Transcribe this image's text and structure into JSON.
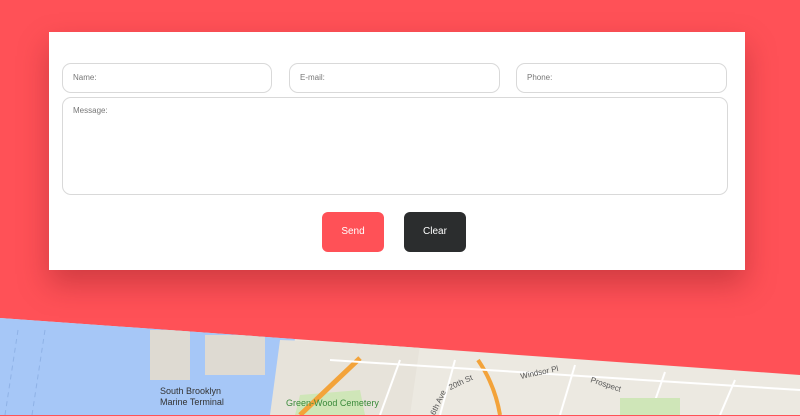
{
  "form": {
    "name_placeholder": "Name:",
    "email_placeholder": "E-mail:",
    "phone_placeholder": "Phone:",
    "message_placeholder": "Message:",
    "send_label": "Send",
    "clear_label": "Clear"
  },
  "map": {
    "terminal_label_line1": "South Brooklyn",
    "terminal_label_line2": "Marine Terminal",
    "cemetery_label": "Green-Wood Cemetery",
    "street_6th_ave": "6th Ave",
    "street_20th": "20th St",
    "street_windsor": "Windsor Pl",
    "street_prospect": "Prospect"
  },
  "colors": {
    "accent": "#ff5157",
    "dark_button": "#2b2d2e",
    "water": "#a6c7f7",
    "land": "#ece9e1",
    "park": "#cfe6b8",
    "highway": "#f3a33a"
  }
}
